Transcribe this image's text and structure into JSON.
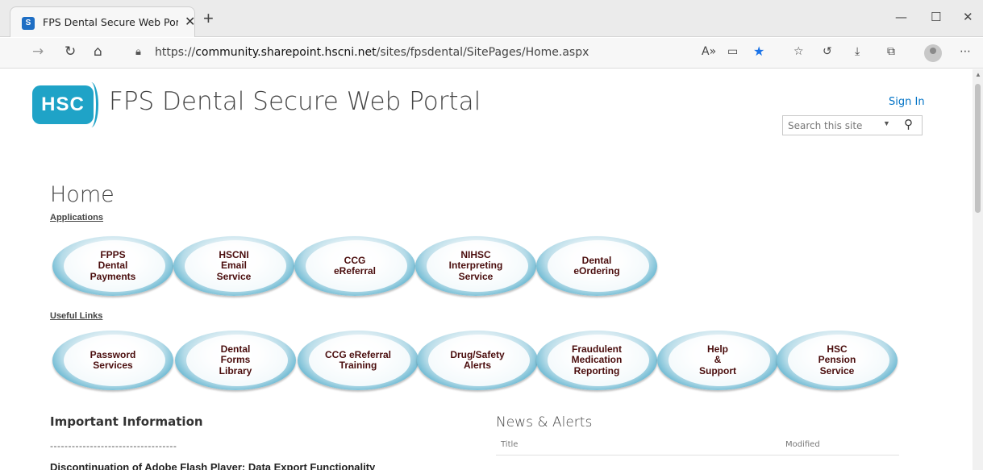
{
  "browser": {
    "tab_title": "FPS Dental Secure Web Portal - H",
    "tab_favicon_letter": "S",
    "url_prefix": "https://",
    "url_domain": "community.sharepoint.hscni.net",
    "url_path": "/sites/fpsdental/SitePages/Home.aspx"
  },
  "site": {
    "logo_text": "HSC",
    "title": "FPS Dental Secure Web Portal",
    "sign_in": "Sign In",
    "search_placeholder": "Search this site"
  },
  "page": {
    "heading": "Home",
    "applications_label": "Applications",
    "useful_links_label": "Useful Links",
    "applications": [
      {
        "label": "FPPS\nDental\nPayments"
      },
      {
        "label": "HSCNI\nEmail\nService"
      },
      {
        "label": "CCG\neReferral"
      },
      {
        "label": "NIHSC\nInterpreting\nService"
      },
      {
        "label": "Dental\neOrdering"
      }
    ],
    "useful_links": [
      {
        "label": "Password\nServices"
      },
      {
        "label": "Dental\nForms\nLibrary"
      },
      {
        "label": "CCG eReferral\nTraining"
      },
      {
        "label": "Drug/Safety\nAlerts"
      },
      {
        "label": "Fraudulent\nMedication\nReporting"
      },
      {
        "label": "Help\n&\nSupport"
      },
      {
        "label": "HSC\nPension\nService"
      }
    ],
    "important_heading": "Important Information",
    "important_dashes": "-----------------------------------",
    "important_next_line": "Discontinuation of Adobe Flash Player: Data Export Functionality",
    "news_heading": "News & Alerts",
    "news_col_title": "Title",
    "news_col_modified": "Modified"
  },
  "colors": {
    "brand": "#1fa3c7",
    "link": "#0072c6",
    "button_text": "#4a0d0d"
  }
}
